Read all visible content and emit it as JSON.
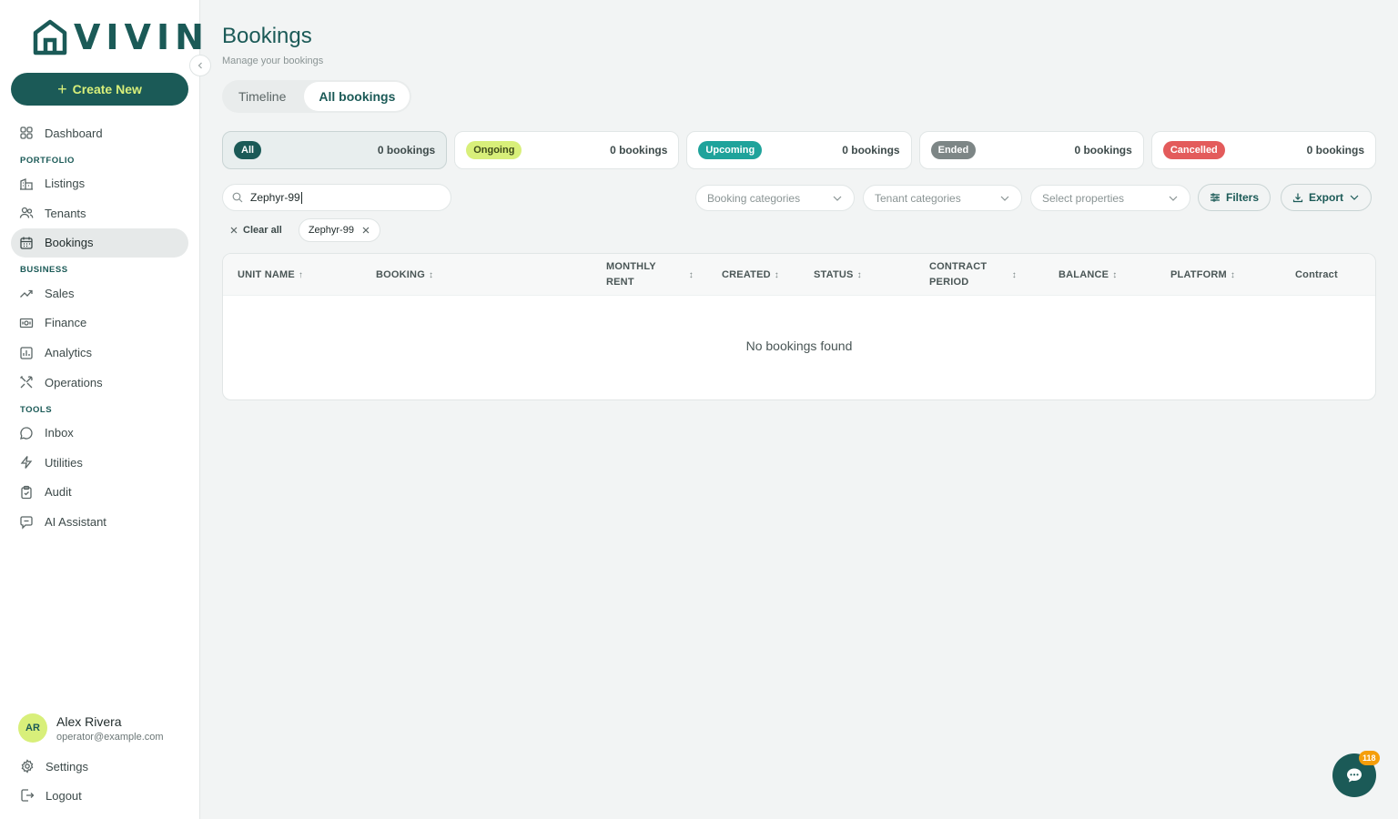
{
  "brand": {
    "logo_text": "VIVIN",
    "accent": "#1b5a57",
    "lime": "#d8ef7a"
  },
  "sidebar": {
    "create_label": "Create New",
    "items_top": [
      {
        "label": "Dashboard",
        "icon": "grid-icon"
      }
    ],
    "sections": [
      {
        "title": "PORTFOLIO",
        "items": [
          {
            "label": "Listings",
            "icon": "building-icon"
          },
          {
            "label": "Tenants",
            "icon": "users-icon"
          },
          {
            "label": "Bookings",
            "icon": "calendar-icon",
            "active": true
          }
        ]
      },
      {
        "title": "BUSINESS",
        "items": [
          {
            "label": "Sales",
            "icon": "trend-icon"
          },
          {
            "label": "Finance",
            "icon": "banknote-icon"
          },
          {
            "label": "Analytics",
            "icon": "bar-chart-icon"
          },
          {
            "label": "Operations",
            "icon": "tools-icon"
          }
        ]
      },
      {
        "title": "TOOLS",
        "items": [
          {
            "label": "Inbox",
            "icon": "chat-bubble-icon"
          },
          {
            "label": "Utilities",
            "icon": "bolt-icon"
          },
          {
            "label": "Audit",
            "icon": "clipboard-icon"
          },
          {
            "label": "AI Assistant",
            "icon": "ai-chat-icon"
          }
        ]
      }
    ],
    "user": {
      "initials": "AR",
      "name": "Alex Rivera",
      "email": "operator@example.com"
    },
    "settings_label": "Settings",
    "logout_label": "Logout"
  },
  "page": {
    "title": "Bookings",
    "subtitle": "Manage your bookings",
    "tabs": [
      {
        "label": "Timeline"
      },
      {
        "label": "All bookings",
        "active": true
      }
    ]
  },
  "status_cards": [
    {
      "label": "All",
      "count": "0 bookings",
      "color": "#1b5a57",
      "text_color": "#ffffff",
      "active": true
    },
    {
      "label": "Ongoing",
      "count": "0 bookings",
      "color": "#d8ef7a",
      "text_color": "#3d4a1a"
    },
    {
      "label": "Upcoming",
      "count": "0 bookings",
      "color": "#1fa39b",
      "text_color": "#ffffff"
    },
    {
      "label": "Ended",
      "count": "0 bookings",
      "color": "#7d8686",
      "text_color": "#ffffff"
    },
    {
      "label": "Cancelled",
      "count": "0 bookings",
      "color": "#e35b5b",
      "text_color": "#ffffff"
    }
  ],
  "filters": {
    "search_value": "Zephyr-99",
    "booking_categories": "Booking categories",
    "tenant_categories": "Tenant categories",
    "select_properties": "Select properties",
    "filters_label": "Filters",
    "export_label": "Export",
    "clear_all": "Clear all",
    "active_chip": "Zephyr-99"
  },
  "table": {
    "columns": [
      {
        "line1": "UNIT NAME",
        "line2": "",
        "sort": "↑"
      },
      {
        "line1": "BOOKING",
        "line2": "",
        "sort": "↕"
      },
      {
        "line1": "MONTHLY",
        "line2": "RENT",
        "sort": "↕"
      },
      {
        "line1": "CREATED",
        "line2": "",
        "sort": "↕"
      },
      {
        "line1": "STATUS",
        "line2": "",
        "sort": "↕"
      },
      {
        "line1": "CONTRACT",
        "line2": "PERIOD",
        "sort": "↕"
      },
      {
        "line1": "BALANCE",
        "line2": "",
        "sort": "↕"
      },
      {
        "line1": "PLATFORM",
        "line2": "",
        "sort": "↕"
      },
      {
        "line1": "Contract",
        "line2": "",
        "sort": ""
      }
    ],
    "empty_message": "No bookings found"
  },
  "chat": {
    "badge": "118"
  }
}
